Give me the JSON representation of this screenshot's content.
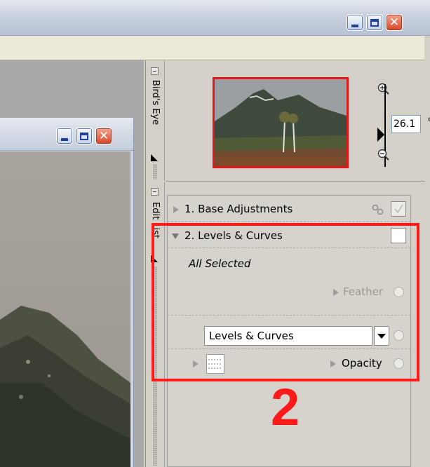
{
  "panels": {
    "birds_eye": {
      "label": "Bird's Eye",
      "zoom_value": "26.1",
      "zoom_unit": "%"
    },
    "edit_list": {
      "label": "Edit List",
      "steps": [
        {
          "label": "1. Base Adjustments"
        },
        {
          "label": "2. Levels & Curves"
        }
      ],
      "selection_text": "All Selected",
      "feather_label": "Feather",
      "dropdown_value": "Levels & Curves",
      "opacity_label": "Opacity"
    }
  },
  "annotation": {
    "label": "2",
    "color": "#ff1a1a"
  },
  "colors": {
    "highlight": "#ff1a1a",
    "thumb_border": "#e0171b"
  }
}
